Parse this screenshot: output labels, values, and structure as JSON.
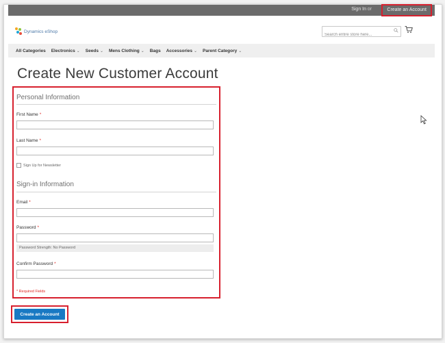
{
  "header": {
    "sign_in_label": "Sign In",
    "or_label": "or",
    "create_account_link": "Create an Account",
    "logo_text": "Dynamics eShop",
    "search_placeholder": "Search entire store here...",
    "icons": [
      "search-icon",
      "cart-icon"
    ]
  },
  "nav": {
    "items": [
      {
        "label": "All Categories",
        "has_dropdown": false
      },
      {
        "label": "Electronics",
        "has_dropdown": true
      },
      {
        "label": "Seeds",
        "has_dropdown": true
      },
      {
        "label": "Mens Clothing",
        "has_dropdown": true
      },
      {
        "label": "Bags",
        "has_dropdown": false
      },
      {
        "label": "Accessories",
        "has_dropdown": true
      },
      {
        "label": "Parent Category",
        "has_dropdown": true
      }
    ],
    "chevron": "⌄"
  },
  "page": {
    "title": "Create New Customer Account"
  },
  "form": {
    "personal_legend": "Personal Information",
    "first_name_label": "First Name",
    "last_name_label": "Last Name",
    "required_mark": "*",
    "newsletter_label": "Sign Up for Newsletter",
    "signin_legend": "Sign-in Information",
    "email_label": "Email",
    "password_label": "Password",
    "password_strength": "Password Strength: No Password",
    "confirm_password_label": "Confirm Password",
    "required_note": "* Required Fields",
    "submit_label": "Create an Account"
  },
  "colors": {
    "highlight": "#d71f2d",
    "primary_button": "#1979c3",
    "required": "#e02b27"
  }
}
